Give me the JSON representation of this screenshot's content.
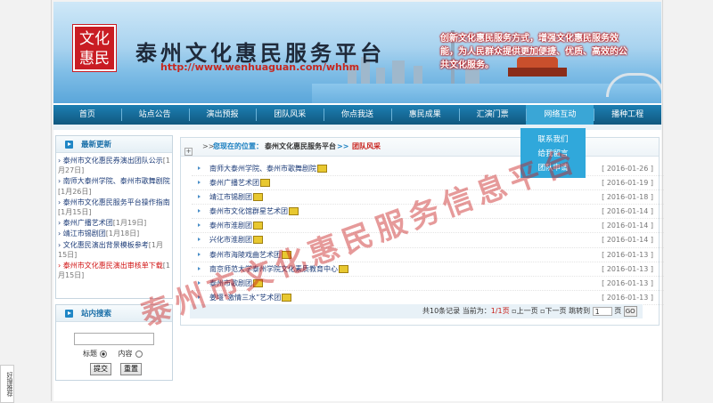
{
  "header": {
    "logo_text": "文化惠民",
    "site_title": "泰州文化惠民服务平台",
    "url": "http://www.wenhuaguan.com/whhm",
    "slogan": "创新文化惠民服务方式，增强文化惠民服务效能，为人民群众提供更加便捷、优质、高效的公共文化服务。"
  },
  "nav": {
    "items": [
      "首页",
      "站点公告",
      "演出预报",
      "团队风采",
      "你点我送",
      "惠民成果",
      "汇演门票",
      "网络互动",
      "播种工程"
    ],
    "active": "网络互动",
    "dropdown": [
      "联系我们",
      "给我留言",
      "团队申请"
    ]
  },
  "sidebar": {
    "latest_title": "最新更新",
    "latest": [
      {
        "title": "泰州市文化惠民券演出团队公示",
        "date": "[1月27日]",
        "red": false
      },
      {
        "title": "南师大泰州学院、泰州市歌舞剧院",
        "date": "[1月26日]",
        "red": false
      },
      {
        "title": "泰州市文化惠民服务平台操作指南",
        "date": "[1月15日]",
        "red": false
      },
      {
        "title": "泰州广播艺术团",
        "date": "[1月19日]",
        "red": false
      },
      {
        "title": "靖江市锡剧团",
        "date": "[1月18日]",
        "red": false
      },
      {
        "title": "文化惠民演出背景模板参考",
        "date": "[1月15日]",
        "red": false
      },
      {
        "title": "泰州市文化惠民演出审核单下载",
        "date": "[1月15日]",
        "red": true
      }
    ],
    "search_title": "站内搜索",
    "search_value": "",
    "radio_title": "标题",
    "radio_content": "内容",
    "submit": "提交",
    "reset": "重置"
  },
  "main": {
    "crumb_prefix": ">>",
    "crumb_here": "您现在的位置：",
    "crumb_site": "泰州文化惠民服务平台",
    "crumb_sep": ">>",
    "crumb_current": "团队风采",
    "rows": [
      {
        "title": "南师大泰州学院、泰州市歌舞剧院",
        "date": "[ 2016-01-26 ]"
      },
      {
        "title": "泰州广播艺术团",
        "date": "[ 2016-01-19 ]"
      },
      {
        "title": "靖江市锡剧团",
        "date": "[ 2016-01-18 ]"
      },
      {
        "title": "泰州市文化馆群星艺术团",
        "date": "[ 2016-01-14 ]"
      },
      {
        "title": "泰州市淮剧团",
        "date": "[ 2016-01-14 ]"
      },
      {
        "title": "兴化市淮剧团",
        "date": "[ 2016-01-14 ]"
      },
      {
        "title": "泰州市海陵戏曲艺术团",
        "date": "[ 2016-01-13 ]"
      },
      {
        "title": "南京师范大学泰州学院文化素质教育中心",
        "date": "[ 2016-01-13 ]"
      },
      {
        "title": "泰州市歌剧团",
        "date": "[ 2016-01-13 ]"
      },
      {
        "title": "姜堰“激情三水”艺术团",
        "date": "[ 2016-01-13 ]"
      }
    ],
    "pager": {
      "total": "共10条记录 当前为：",
      "page": "1/1页",
      "prev": "上一页",
      "next": "下一页",
      "jump": "跳转到",
      "page_input": "1",
      "unit": "页",
      "go": "GO"
    }
  },
  "watermark": "泰州市文化惠民服务信息平台",
  "side_tab": "好搜推荐",
  "colors": {
    "nav": "#1d7fb3",
    "accent_red": "#c8201a",
    "link_blue": "#1a7fc0"
  }
}
